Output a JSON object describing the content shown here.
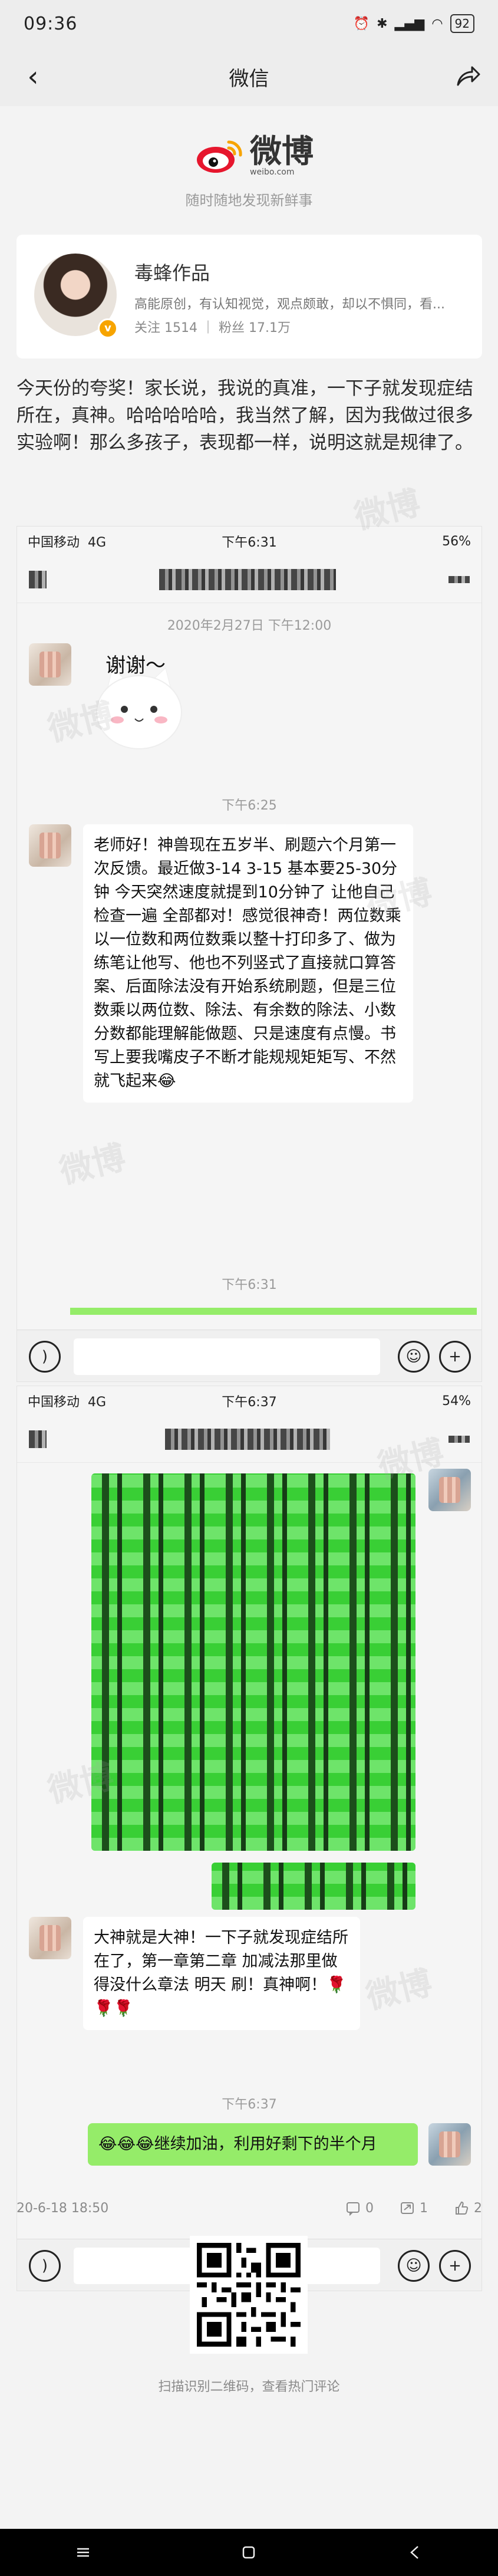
{
  "status": {
    "time": "09:36",
    "battery": "92"
  },
  "nav": {
    "title": "微信"
  },
  "weibo": {
    "logo": "微博",
    "url": "weibo.com",
    "slogan": "随时随地发现新鲜事",
    "author": "毒蜂作品",
    "desc": "高能原创，有认知视觉，观点颇敢，却以不惧同，看...",
    "stats": "关注 1514 ｜ 粉丝 17.1万",
    "verify": "v"
  },
  "post": {
    "text": "今天份的夸奖！家长说，我说的真准，一下子就发现症结所在，真神。哈哈哈哈哈，我当然了解，因为我做过很多实验啊！那么多孩子，表现都一样，说明这就是规律了。"
  },
  "shot1": {
    "carrier": "中国移动",
    "network": "4G",
    "time": "下午6:31",
    "battery": "56%",
    "date": "2020年2月27日 下午12:00",
    "sticker_text": "谢谢～",
    "stamp1": "下午6:25",
    "message": "老师好！神兽现在五岁半、刷题六个月第一次反馈。最近做3-14 3-15 基本要25-30分钟 今天突然速度就提到10分钟了 让他自己检查一遍 全部都对！感觉很神奇！两位数乘以一位数和两位数乘以整十打印多了、做为练笔让他写、他也不列竖式了直接就口算答案、后面除法没有开始系统刷题，但是三位数乘以两位数、除法、有余数的除法、小数分数都能理解能做题、只是速度有点慢。书写上要我嘴皮子不断才能规规矩矩写、不然就飞起来😂",
    "stamp2": "下午6:31"
  },
  "shot2": {
    "carrier": "中国移动",
    "network": "4G",
    "time": "下午6:37",
    "battery": "54%",
    "msg_left": "大神就是大神！一下子就发现症结所在了，第一章第二章 加减法那里做得没什么章法 明天 刷！真神啊！🌹🌹🌹",
    "stamp": "下午6:37",
    "msg_right": "😂😂😂继续加油，利用好剩下的半个月"
  },
  "footer": {
    "date": "20-6-18 18:50",
    "comments": "0",
    "reposts": "1",
    "likes": "2",
    "qr_hint": "扫描识别二维码，查看热门评论"
  },
  "watermark": "微博"
}
